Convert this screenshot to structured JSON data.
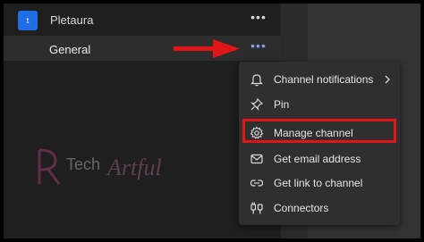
{
  "team": {
    "avatar_letter": "t",
    "name": "Pletaura",
    "more_label": "•••"
  },
  "channel": {
    "name": "General",
    "more_label": "•••"
  },
  "watermark": {
    "text_a": "Tech",
    "text_b": "Artful"
  },
  "menu": {
    "items": [
      {
        "label": "Channel notifications",
        "icon": "bell-icon",
        "has_submenu": true
      },
      {
        "label": "Pin",
        "icon": "pin-icon",
        "has_submenu": false
      },
      {
        "label": "Manage channel",
        "icon": "gear-icon",
        "has_submenu": false,
        "highlighted": true
      },
      {
        "label": "Get email address",
        "icon": "email-icon",
        "has_submenu": false
      },
      {
        "label": "Get link to channel",
        "icon": "link-icon",
        "has_submenu": false
      },
      {
        "label": "Connectors",
        "icon": "connectors-icon",
        "has_submenu": false
      }
    ]
  },
  "colors": {
    "accent": "#1e6ee8",
    "annotation_red": "#e01616",
    "more_active": "#8f95f0"
  }
}
